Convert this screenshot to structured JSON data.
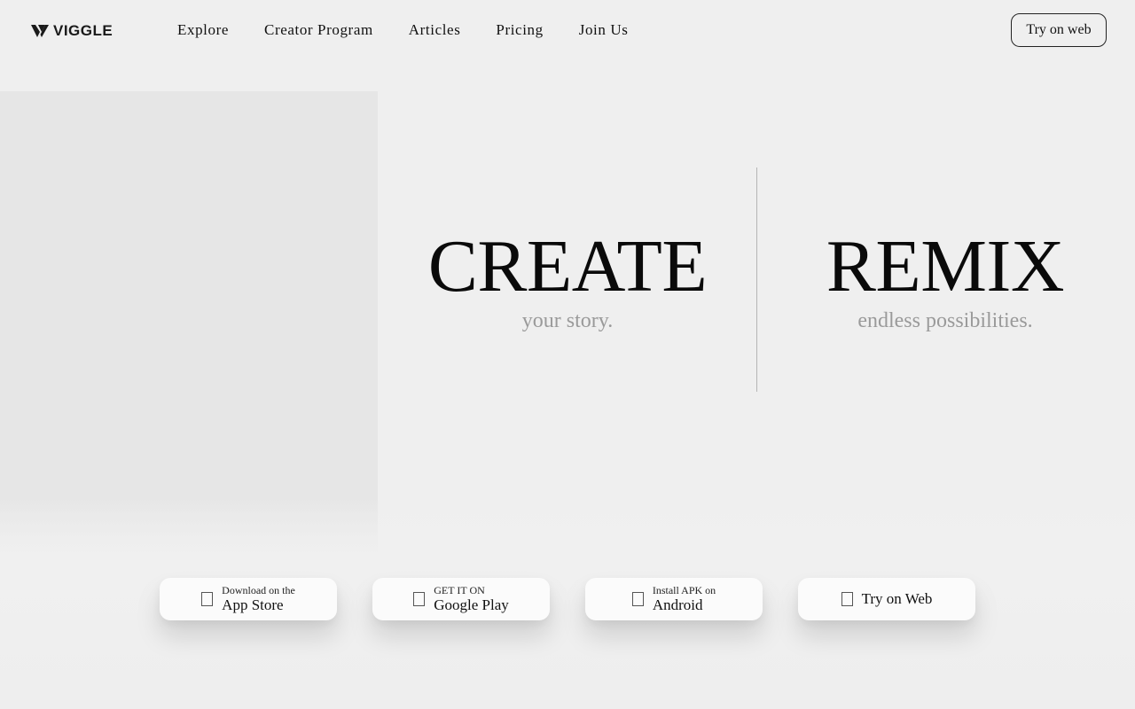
{
  "brand": {
    "name": "VIGGLE"
  },
  "nav": {
    "items": [
      {
        "label": "Explore"
      },
      {
        "label": "Creator Program"
      },
      {
        "label": "Articles"
      },
      {
        "label": "Pricing"
      },
      {
        "label": "Join Us"
      }
    ]
  },
  "header": {
    "cta_label": "Try on web"
  },
  "hero": {
    "left": {
      "title": "CREATE",
      "subtitle": "your story."
    },
    "right": {
      "title": "REMIX",
      "subtitle": "endless possibilities."
    }
  },
  "downloads": [
    {
      "small": "Download on the",
      "big": "App Store",
      "icon": "apple-icon"
    },
    {
      "small": "GET IT ON",
      "big": "Google Play",
      "icon": "google-play-icon"
    },
    {
      "small": "Install APK on",
      "big": "Android",
      "icon": "android-icon"
    },
    {
      "label": "Try on Web",
      "icon": "globe-icon"
    }
  ],
  "colors": {
    "background": "#efefef",
    "text": "#111111",
    "subtitle": "#9a9a9a",
    "panel": "#e6e6e6"
  }
}
